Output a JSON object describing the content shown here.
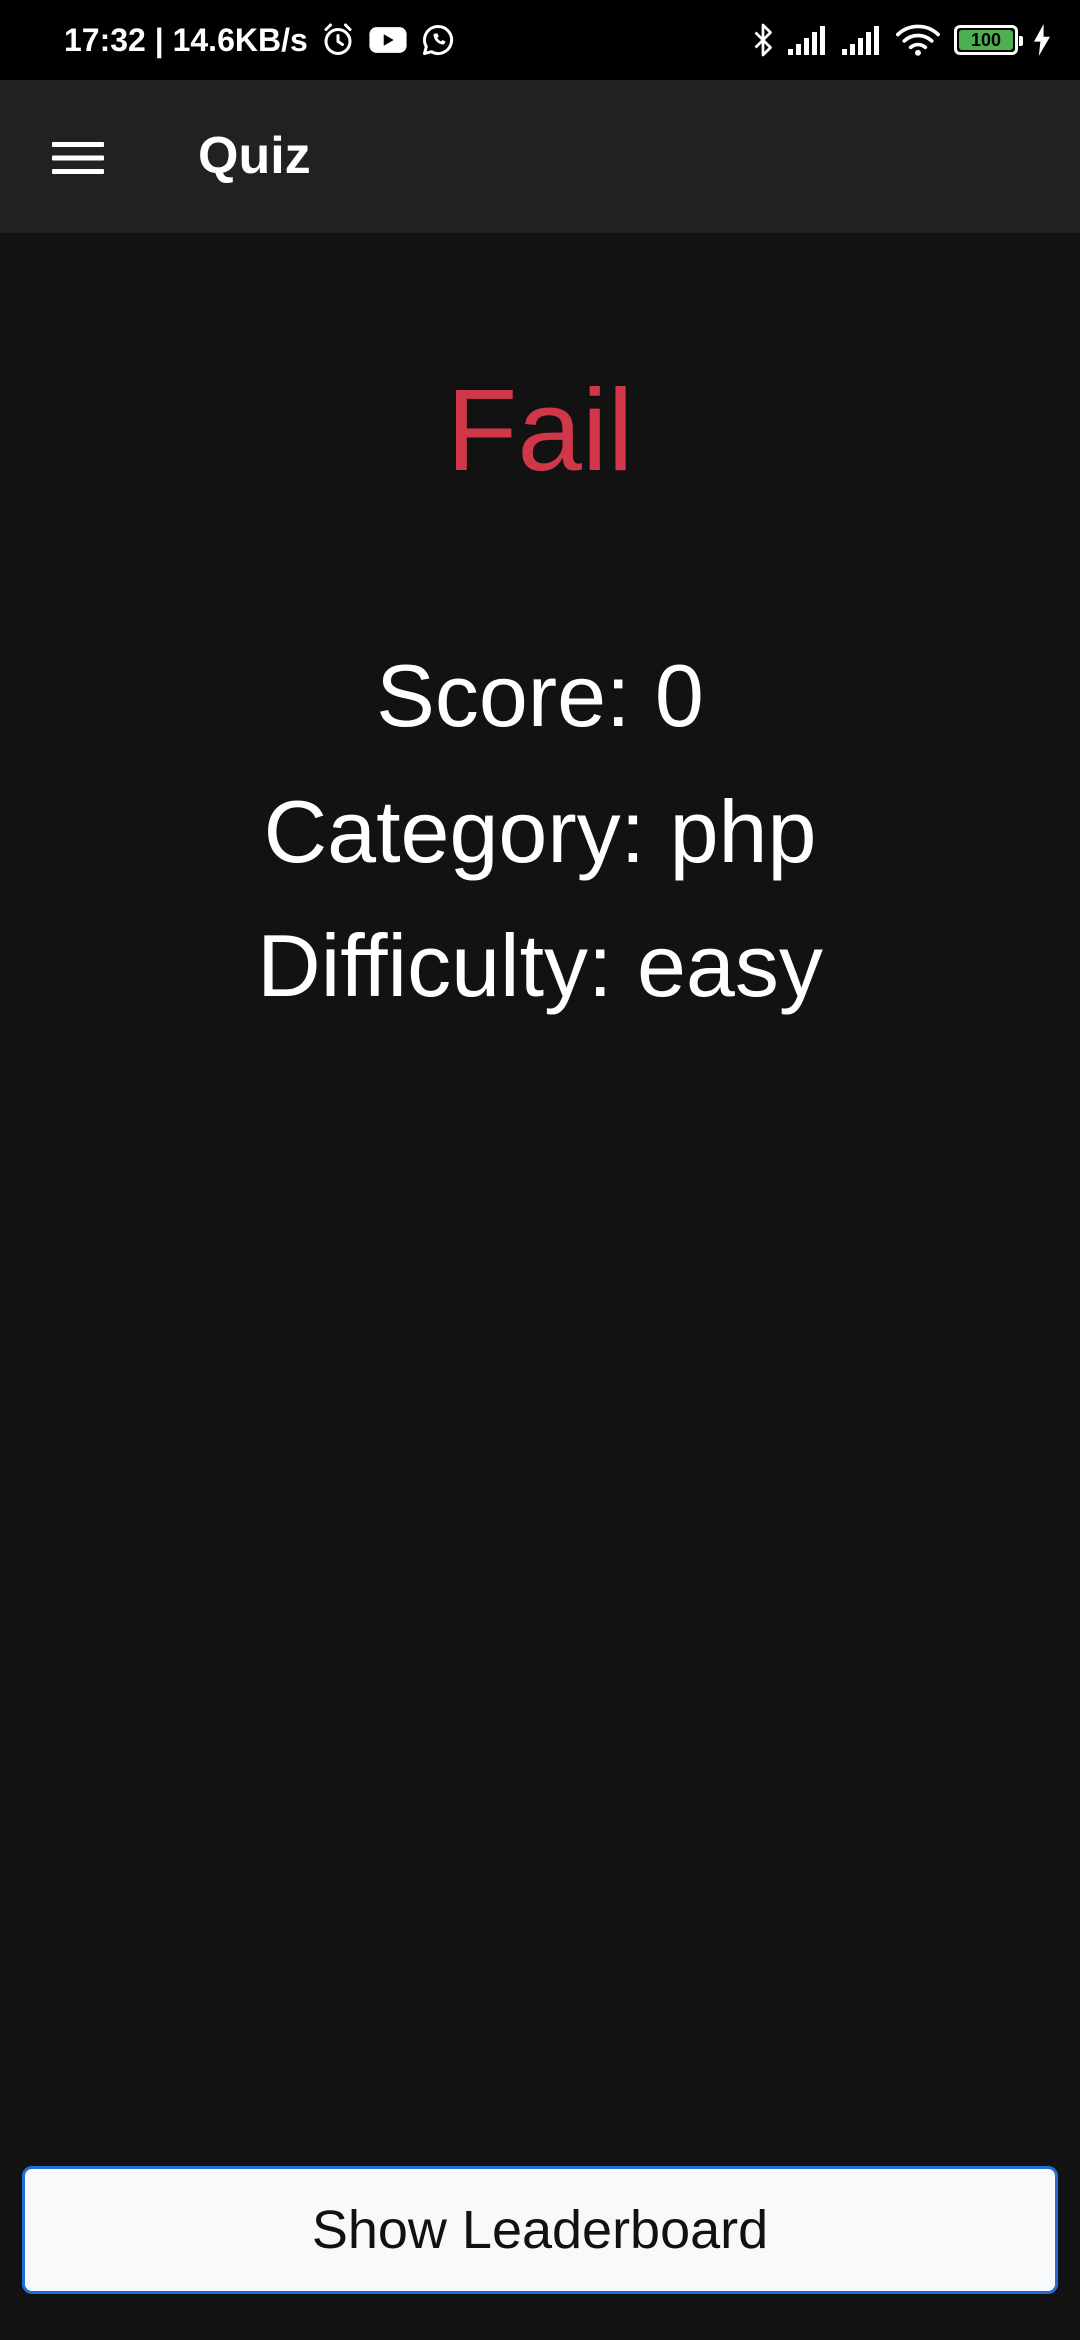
{
  "status_bar": {
    "time_speed": "17:32 | 14.6KB/s",
    "battery_level": "100",
    "battery_color": "#4caf50",
    "left_icons": [
      "alarm-icon",
      "youtube-icon",
      "whatsapp-icon"
    ],
    "right_icons": [
      "bluetooth-icon",
      "signal-icon",
      "signal-icon",
      "wifi-icon",
      "battery-icon",
      "charging-icon"
    ]
  },
  "app_bar": {
    "title": "Quiz",
    "menu_icon": "hamburger-menu-icon"
  },
  "result": {
    "status": "Fail",
    "status_color": "#d0384a",
    "score_label": "Score: ",
    "score_value": "0",
    "category_label": "Category: ",
    "category_value": "php",
    "difficulty_label": "Difficulty: ",
    "difficulty_value": "easy"
  },
  "actions": {
    "leaderboard_label": "Show Leaderboard",
    "accent_color": "#1e6fd9"
  }
}
